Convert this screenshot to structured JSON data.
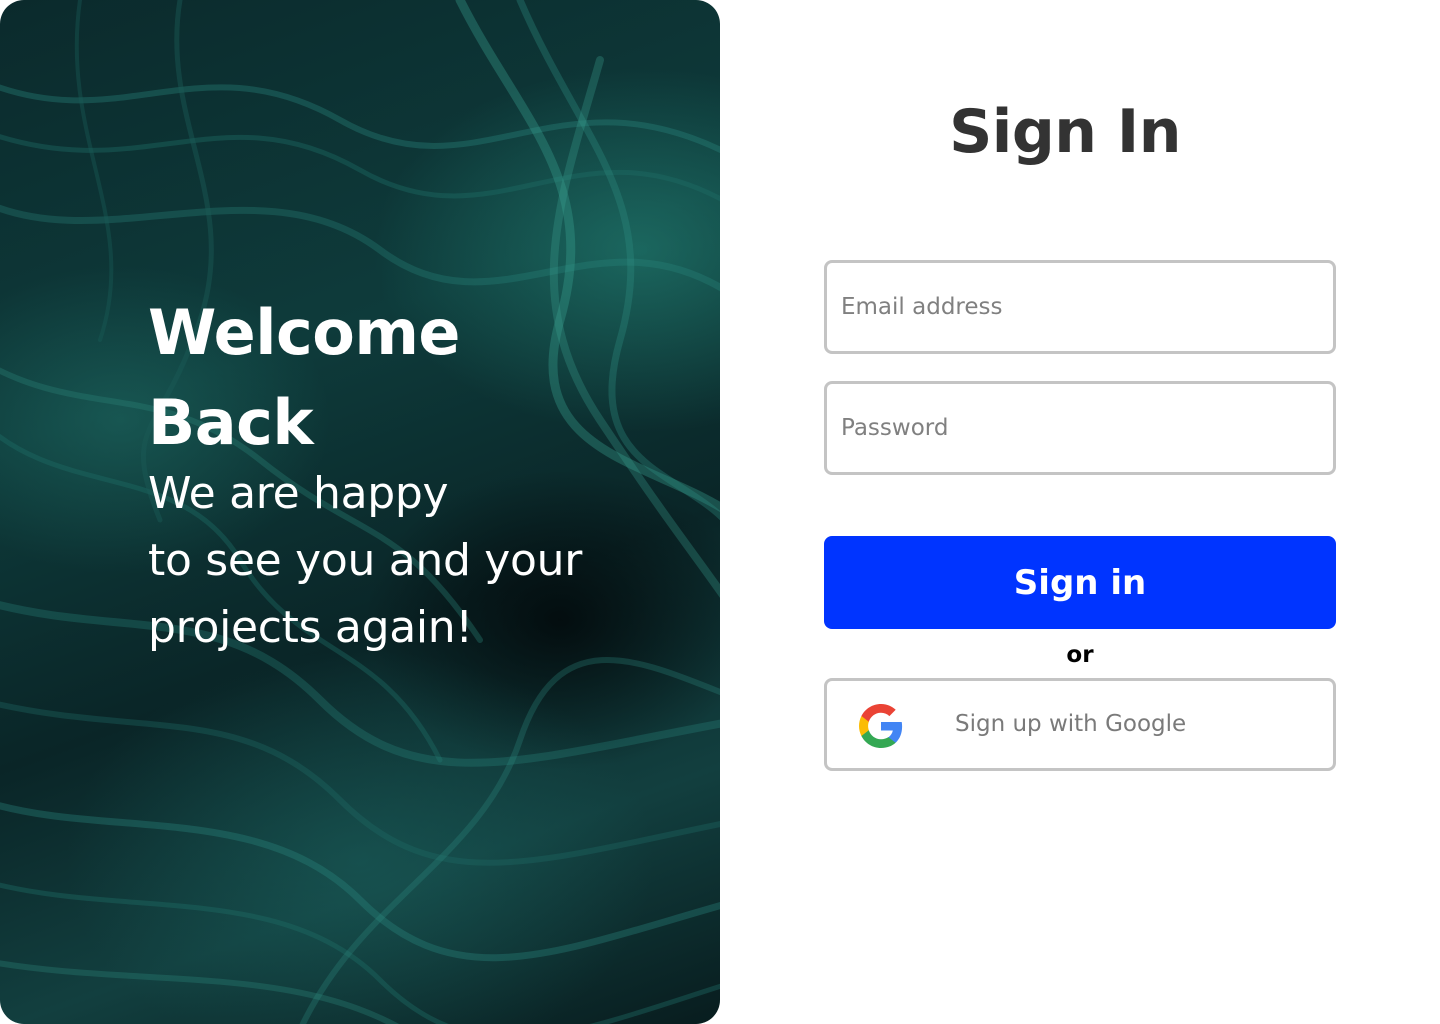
{
  "hero": {
    "title": "Welcome Back",
    "subtitle_lines": [
      "We are happy",
      "to see you and your",
      "projects again!"
    ]
  },
  "form": {
    "title": "Sign In",
    "email": {
      "placeholder": "Email address",
      "value": ""
    },
    "password": {
      "placeholder": "Password",
      "value": ""
    },
    "signin_label": "Sign in",
    "or_label": "or",
    "google_label": "Sign up with Google"
  },
  "colors": {
    "primary_button": "#0034ff",
    "title_text": "#333333",
    "field_border": "#c4c4c4",
    "hero_tint": "#0e3b3b"
  },
  "icons": {
    "google": "google-g-icon"
  }
}
